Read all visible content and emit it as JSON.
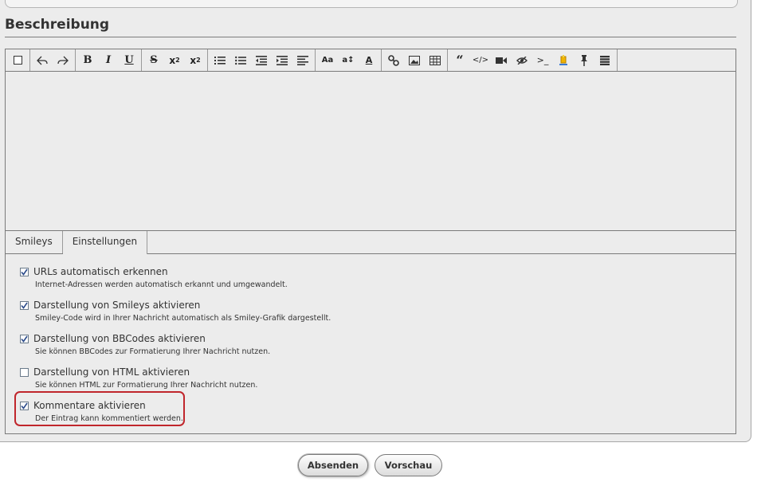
{
  "section": {
    "title": "Beschreibung"
  },
  "toolbar": {
    "groups": [
      [
        "source-mode-icon"
      ],
      [
        "undo-icon",
        "redo-icon"
      ],
      [
        "bold-icon",
        "italic-icon",
        "underline-icon"
      ],
      [
        "strikethrough-icon",
        "subscript-icon",
        "superscript-icon"
      ],
      [
        "ordered-list-icon",
        "unordered-list-icon",
        "outdent-icon",
        "indent-icon",
        "align-icon"
      ],
      [
        "font-size-icon",
        "font-resize-icon",
        "font-color-icon"
      ],
      [
        "link-icon",
        "image-icon",
        "table-icon"
      ],
      [
        "quote-icon",
        "code-icon",
        "video-icon",
        "hide-icon",
        "terminal-icon",
        "highlight-icon",
        "pin-icon",
        "more-icon"
      ]
    ]
  },
  "tabs": [
    {
      "label": "Smileys"
    },
    {
      "label": "Einstellungen"
    }
  ],
  "options": [
    {
      "label": "URLs automatisch erkennen",
      "desc": "Internet-Adressen werden automatisch erkannt und umgewandelt.",
      "checked": true
    },
    {
      "label": "Darstellung von Smileys aktivieren",
      "desc": "Smiley-Code wird in Ihrer Nachricht automatisch als Smiley-Grafik dargestellt.",
      "checked": true
    },
    {
      "label": "Darstellung von BBCodes aktivieren",
      "desc": "Sie können BBCodes zur Formatierung Ihrer Nachricht nutzen.",
      "checked": true
    },
    {
      "label": "Darstellung von HTML aktivieren",
      "desc": "Sie können HTML zur Formatierung Ihrer Nachricht nutzen.",
      "checked": false
    },
    {
      "label": "Kommentare aktivieren",
      "desc": "Der Eintrag kann kommentiert werden.",
      "checked": true
    }
  ],
  "buttons": {
    "submit": "Absenden",
    "preview": "Vorschau"
  },
  "colors": {
    "highlight": "#c0262c",
    "panel": "#ececec"
  }
}
